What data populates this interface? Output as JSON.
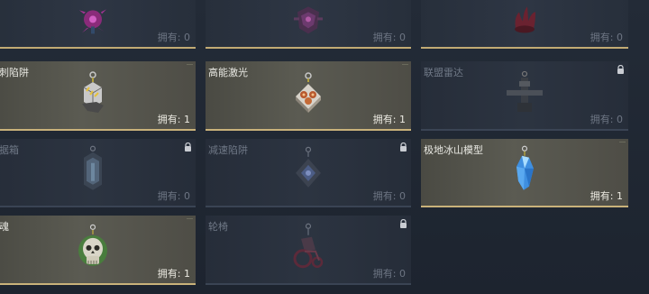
{
  "count_label": "拥有:",
  "cards": [
    {
      "name": "",
      "count": "0",
      "state": "plain"
    },
    {
      "name": "",
      "count": "0",
      "state": "plain"
    },
    {
      "name": "",
      "count": "0",
      "state": "plain"
    },
    {
      "name": "突刺陷阱",
      "count": "1",
      "state": "owned"
    },
    {
      "name": "高能激光",
      "count": "1",
      "state": "owned"
    },
    {
      "name": "联盟雷达",
      "count": "0",
      "state": "locked"
    },
    {
      "name": "数据箱",
      "count": "0",
      "state": "locked"
    },
    {
      "name": "减速陷阱",
      "count": "0",
      "state": "locked"
    },
    {
      "name": "极地冰山模型",
      "count": "1",
      "state": "owned"
    },
    {
      "name": "幽魂",
      "count": "1",
      "state": "owned"
    },
    {
      "name": "轮椅",
      "count": "0",
      "state": "locked"
    }
  ]
}
